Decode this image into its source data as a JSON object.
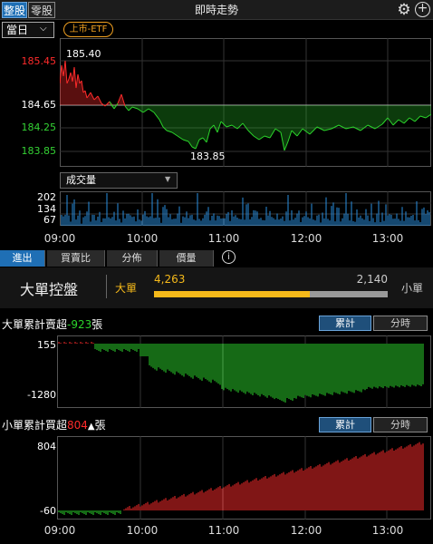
{
  "header": {
    "tab_whole": "整股",
    "tab_odd": "零股",
    "title": "即時走勢",
    "gear_icon": "gear-icon",
    "add_icon": "plus-circle-icon"
  },
  "controls": {
    "period": "當日",
    "market_badge": "上市-ETF"
  },
  "price_chart": {
    "y_labels": [
      {
        "text": "185.45",
        "color": "#ff2b2b"
      },
      {
        "text": "184.65",
        "color": "#ffffff"
      },
      {
        "text": "184.25",
        "color": "#34d234"
      },
      {
        "text": "183.85",
        "color": "#34d234"
      }
    ],
    "high_label": "185.40",
    "low_label": "183.85",
    "ref_price": 184.65,
    "colors": {
      "up": "#ff2b2b",
      "down": "#2bd42b",
      "ref": "#ffffff"
    }
  },
  "volume": {
    "select_label": "成交量",
    "y_labels": [
      "202",
      "134",
      "67"
    ],
    "color": "#2a8fe0"
  },
  "time_axis": [
    "09:00",
    "10:00",
    "11:00",
    "12:00",
    "13:00"
  ],
  "subtabs": {
    "in_out": "進出",
    "buy_sell_ratio": "買賣比",
    "distribution": "分佈",
    "price_volume": "價量",
    "info_icon": "info-icon"
  },
  "big_order": {
    "title": "大單控盤",
    "big_label": "大單",
    "big_value": "4,263",
    "small_value": "2,140",
    "small_label": "小單",
    "big_ratio": 0.666
  },
  "big_cum": {
    "title_prefix": "大單累計賣超",
    "value": "-923",
    "title_suffix": "張",
    "btn_cum": "累計",
    "btn_hour": "分時",
    "y_labels": [
      "155",
      "-1280"
    ]
  },
  "small_cum": {
    "title_prefix": "小單累計買超",
    "value": "804",
    "title_suffix": "張",
    "btn_cum": "累計",
    "btn_hour": "分時",
    "y_labels": [
      "804",
      "-60"
    ]
  }
}
